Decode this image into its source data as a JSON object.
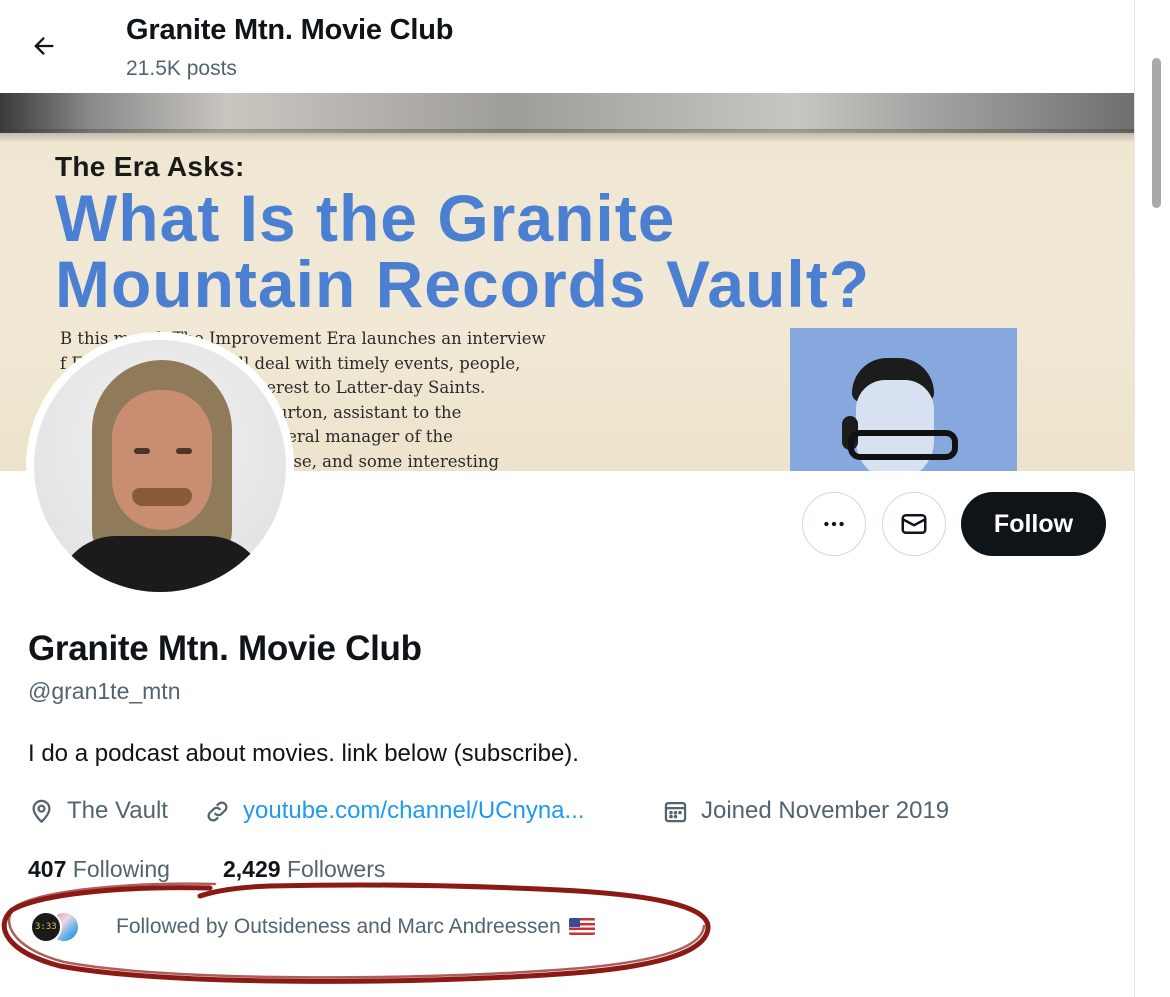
{
  "header": {
    "title": "Granite Mtn. Movie Club",
    "posts_count": "21.5K posts"
  },
  "banner": {
    "kicker": "The Era Asks:",
    "headline_line1": "What Is the Granite",
    "headline_line2": "Mountain Records Vault?",
    "body_lines": [
      "B      this month The Improvement Era launches an interview",
      "f        Era Asks,” which will deal with timely events, people,",
      "           and state of affairs of interest to Latter-day Saints.",
      "           with Elder Theodore M. Burton, assistant to the",
      "           and vice president and general manager of the",
      "           ores the background, purpose, and some interesting"
    ]
  },
  "actions": {
    "more_label": "More",
    "message_label": "Message",
    "follow_label": "Follow"
  },
  "profile": {
    "name": "Granite Mtn. Movie Club",
    "handle": "@gran1te_mtn",
    "bio": "I do a podcast about movies. link below (subscribe).",
    "location": "The Vault",
    "link": "youtube.com/channel/UCnyna...",
    "joined": "Joined November 2019"
  },
  "stats": {
    "following_count": "407",
    "following_label": "Following",
    "followers_count": "2,429",
    "followers_label": "Followers"
  },
  "followed_by": {
    "text": "Followed by Outsideness and Marc Andreessen",
    "flag_icon": "us-flag-icon"
  },
  "colors": {
    "link_blue": "#1d9bf0",
    "secondary_text": "#536471",
    "primary_text": "#0f1419",
    "annotation_red": "#8b1a14"
  }
}
